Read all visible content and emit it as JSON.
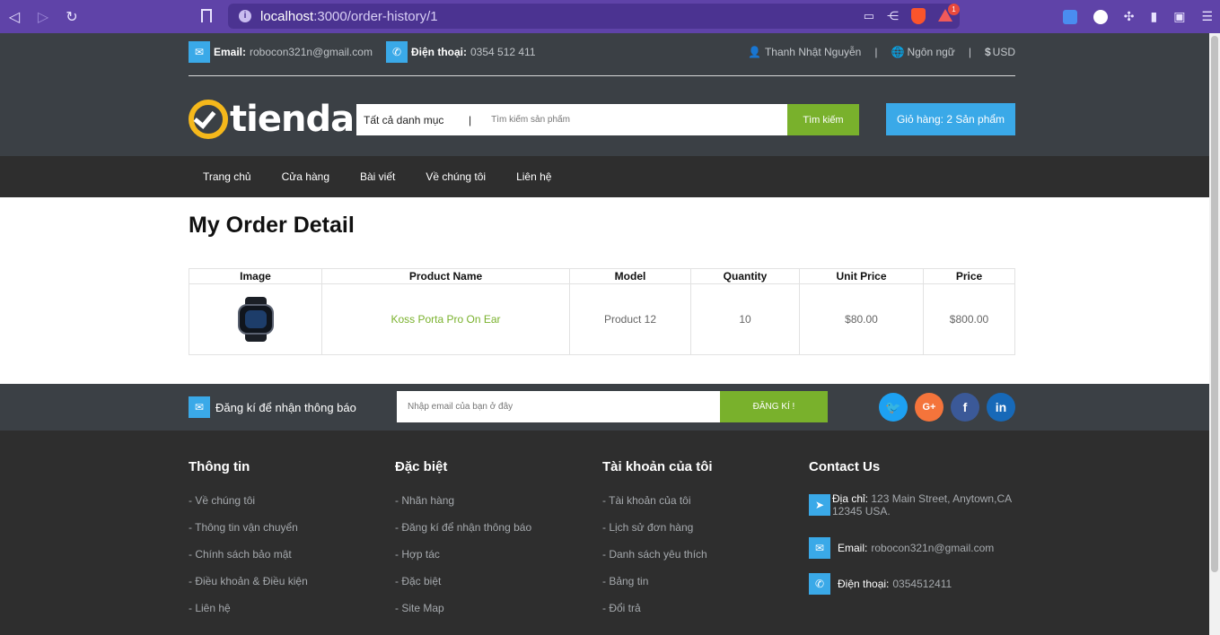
{
  "browser": {
    "url_host": "localhost",
    "url_path": ":3000/order-history/1",
    "rewards_badge": "1"
  },
  "topbar": {
    "email_label": "Email:",
    "email_value": "robocon321n@gmail.com",
    "phone_label": "Điện thoại:",
    "phone_value": "0354 512 411",
    "user_name": "Thanh Nhật Nguyễn",
    "language": "Ngôn ngữ",
    "currency": "USD",
    "separator": "|"
  },
  "logo": {
    "text": "tienda"
  },
  "search": {
    "category": "Tất cả danh mục",
    "divider": "|",
    "placeholder": "Tìm kiếm sản phẩm",
    "button": "Tìm kiếm"
  },
  "cart": {
    "label": "Giỏ hàng: 2 Sản phẩm"
  },
  "nav": {
    "items": [
      "Trang chủ",
      "Cửa hàng",
      "Bài viết",
      "Về chúng tôi",
      "Liên hệ"
    ]
  },
  "page": {
    "title": "My Order Detail"
  },
  "order_table": {
    "headers": [
      "Image",
      "Product Name",
      "Model",
      "Quantity",
      "Unit Price",
      "Price"
    ],
    "rows": [
      {
        "image": "smartwatch",
        "name": "Koss Porta Pro On Ear",
        "model": "Product 12",
        "quantity": "10",
        "unit_price": "$80.00",
        "price": "$800.00"
      }
    ]
  },
  "newsletter": {
    "label": "Đăng kí để nhận thông báo",
    "placeholder": "Nhập email của bạn ở đây",
    "button": "ĐĂNG KÍ !"
  },
  "social": [
    {
      "name": "twitter",
      "glyph": "🐦",
      "color": "#1da1f2"
    },
    {
      "name": "google-plus",
      "glyph": "G+",
      "color": "#f4743b"
    },
    {
      "name": "facebook",
      "glyph": "f",
      "color": "#3b5998"
    },
    {
      "name": "linkedin",
      "glyph": "in",
      "color": "#1769b8"
    }
  ],
  "footer": {
    "info": {
      "title": "Thông tin",
      "links": [
        "- Về chúng tôi",
        "- Thông tin vận chuyển",
        "- Chính sách bảo mật",
        "- Điều khoản & Điều kiện",
        "- Liên hệ"
      ]
    },
    "special": {
      "title": "Đặc biệt",
      "links": [
        "- Nhãn hàng",
        "- Đăng kí để nhận thông báo",
        "- Hợp tác",
        "- Đặc biệt",
        "- Site Map"
      ]
    },
    "account": {
      "title": "Tài khoản của tôi",
      "links": [
        "- Tài khoản của tôi",
        "- Lịch sử đơn hàng",
        "- Danh sách yêu thích",
        "- Bảng tin",
        "- Đổi trả"
      ]
    },
    "contact": {
      "title": "Contact Us",
      "address_label": "Địa chỉ:",
      "address_value": "123 Main Street, Anytown,CA 12345 USA.",
      "email_label": "Email:",
      "email_value": "robocon321n@gmail.com",
      "phone_label": "Điện thoại:",
      "phone_value": "0354512411"
    }
  },
  "colors": {
    "browser_bar": "#5f43a8",
    "header_bg": "#3b4045",
    "nav_bg": "#2e2e2e",
    "accent_blue": "#3aa9e8",
    "accent_green": "#79b12c",
    "logo_yellow": "#f5b81b"
  }
}
